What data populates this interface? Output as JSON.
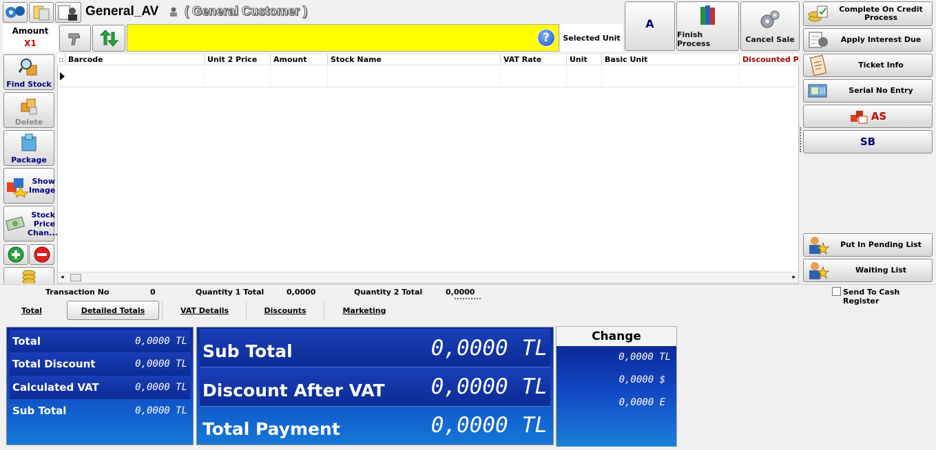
{
  "header": {
    "customer_code": "General_AV",
    "customer_name": "( General Customer )"
  },
  "amount": {
    "label": "Amount",
    "value": "X1"
  },
  "selected_unit_label": "Selected Unit",
  "top_buttons": {
    "a": "A",
    "finish": "Finish Process",
    "cancel": "Cancel Sale"
  },
  "left_buttons": {
    "find_stock": "Find Stock",
    "delete": "Delete",
    "package": "Package",
    "show_image": "Show Image",
    "stock_price": "Stock Price Chan..."
  },
  "grid": {
    "columns": [
      "Barcode",
      "Unit 2 Price",
      "Amount",
      "Stock Name",
      "VAT Rate",
      "Unit",
      "Basic Unit",
      "Discounted Pric"
    ],
    "row_marker": "::"
  },
  "right_buttons": {
    "credit": "Complete On Credit Process",
    "interest": "Apply Interest Due",
    "ticket": "Ticket Info",
    "serial": "Serial No Entry",
    "as": "AS",
    "sb": "SB",
    "pending": "Put In Pending List",
    "waiting": "Waiting List"
  },
  "status": {
    "transaction_label": "Transaction No",
    "transaction_value": "0",
    "qty1_label": "Quantity 1 Total",
    "qty1_value": "0,0000",
    "qty2_label": "Quantity 2 Total",
    "qty2_value": "0,0000",
    "send_label": "Send To Cash Register"
  },
  "tabs": [
    "Total",
    "Detailed Totals",
    "VAT Details",
    "Discounts",
    "Marketing"
  ],
  "totals_left": [
    {
      "label": "Total",
      "value": "0,0000 TL"
    },
    {
      "label": "Total Discount",
      "value": "0,0000 TL"
    },
    {
      "label": "Calculated VAT",
      "value": "0,0000 TL"
    },
    {
      "label": "Sub Total",
      "value": "0,0000 TL"
    }
  ],
  "totals_mid": [
    {
      "label": "Sub Total",
      "value": "0,0000",
      "unit": "TL"
    },
    {
      "label": "Discount After VAT",
      "value": "0,0000",
      "unit": "TL"
    },
    {
      "label": "Total Payment",
      "value": "0,0000",
      "unit": "TL"
    }
  ],
  "change": {
    "title": "Change",
    "values": [
      "0,0000 TL",
      "0,0000 $",
      "0,0000 E"
    ]
  }
}
